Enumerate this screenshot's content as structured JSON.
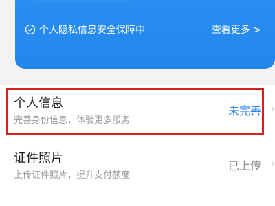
{
  "banner": {
    "privacy_text": "个人隐私信息安全保障中",
    "privacy_icon": "shield-icon",
    "more_link": "查看更多 >",
    "color": "#2287ec"
  },
  "rows": [
    {
      "title": "个人信息",
      "subtitle": "完善身份信息，体验更多服务",
      "status": "未完善",
      "status_color": "#2b88ee"
    },
    {
      "title": "证件照片",
      "subtitle": "上传证件照片，提升支付额度",
      "status": "已上传",
      "status_color": "#8a8a8a"
    }
  ],
  "highlight_color": "#d81e1e"
}
